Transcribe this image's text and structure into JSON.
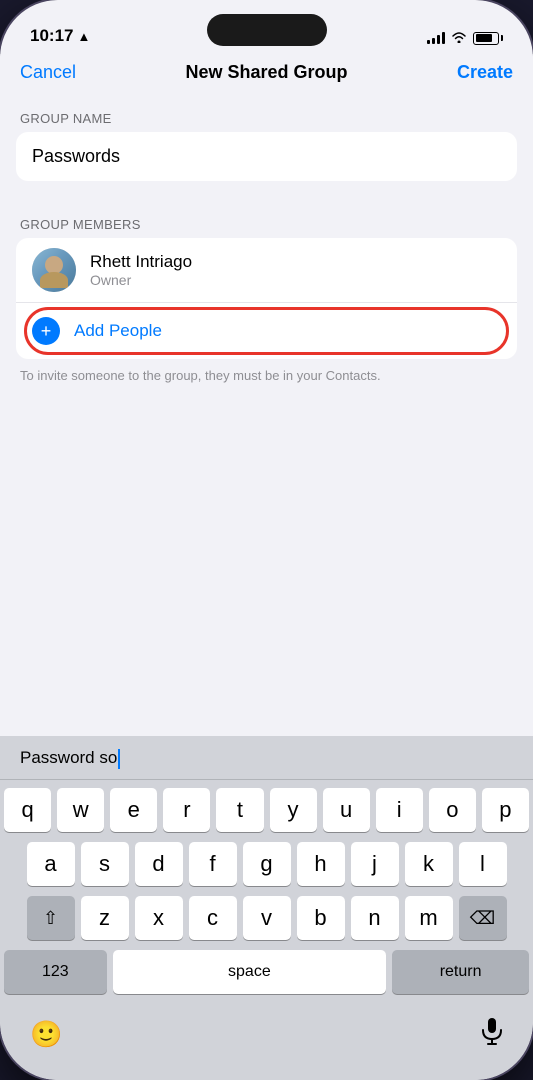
{
  "status_bar": {
    "time": "10:17",
    "battery_level": "83"
  },
  "nav": {
    "cancel_label": "Cancel",
    "title": "New Shared Group",
    "create_label": "Create"
  },
  "form": {
    "group_name_label": "GROUP NAME",
    "group_name_value": "Passwords",
    "group_members_label": "GROUP MEMBERS"
  },
  "member": {
    "name": "Rhett Intriago",
    "role": "Owner"
  },
  "add_people": {
    "label": "Add People",
    "icon": "+"
  },
  "hint": {
    "text": "To invite someone to the group, they must be in your Contacts."
  },
  "keyboard": {
    "suggestion": "Password so",
    "rows": [
      [
        "q",
        "w",
        "e",
        "r",
        "t",
        "y",
        "u",
        "i",
        "o",
        "p"
      ],
      [
        "a",
        "s",
        "d",
        "f",
        "g",
        "h",
        "j",
        "k",
        "l"
      ],
      [
        "z",
        "x",
        "c",
        "v",
        "b",
        "n",
        "m"
      ],
      [
        "123",
        "space",
        "return"
      ]
    ],
    "special": {
      "shift": "⇧",
      "backspace": "⌫",
      "nums": "123",
      "space": "space",
      "return": "return"
    }
  }
}
